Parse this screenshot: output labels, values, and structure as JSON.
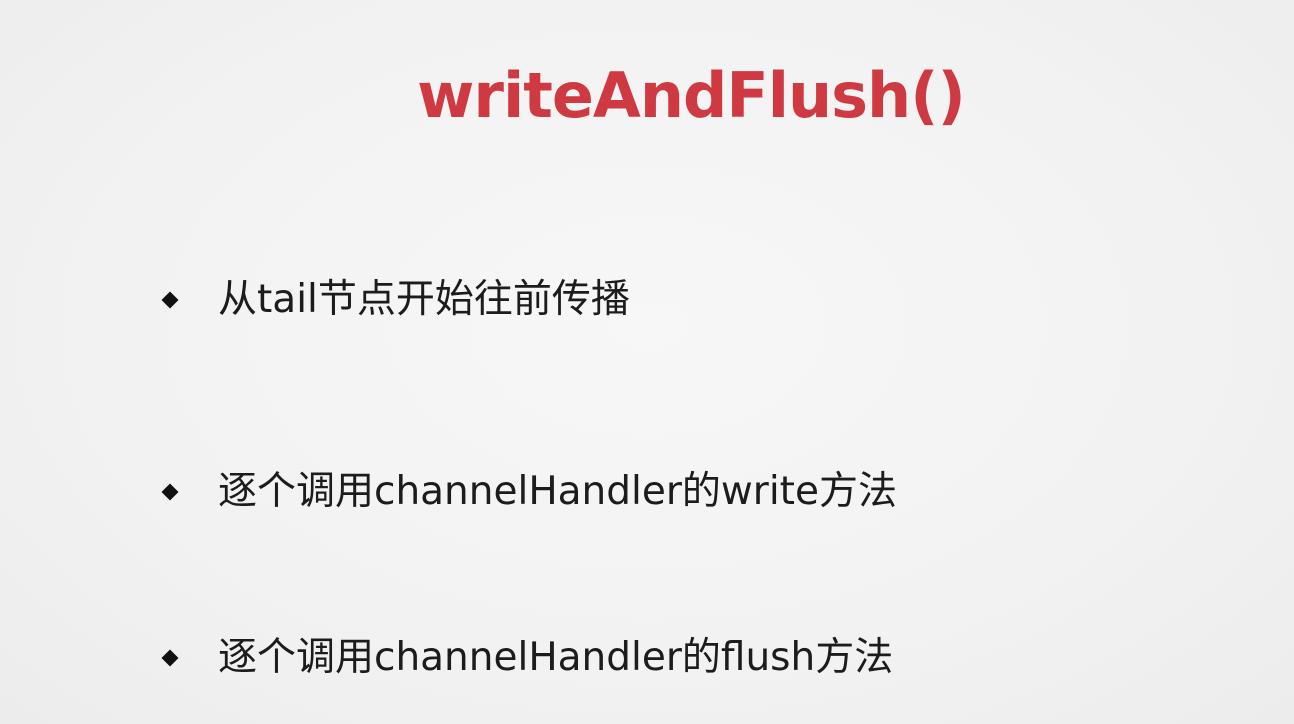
{
  "slide": {
    "title": "writeAndFlush()",
    "title_color": "#cf3a42",
    "bullets": [
      "从tail节点开始往前传播",
      "逐个调用channelHandler的write方法",
      "逐个调用channelHandler的flush方法"
    ],
    "bullet_icon": "diamond-bullet-icon"
  }
}
